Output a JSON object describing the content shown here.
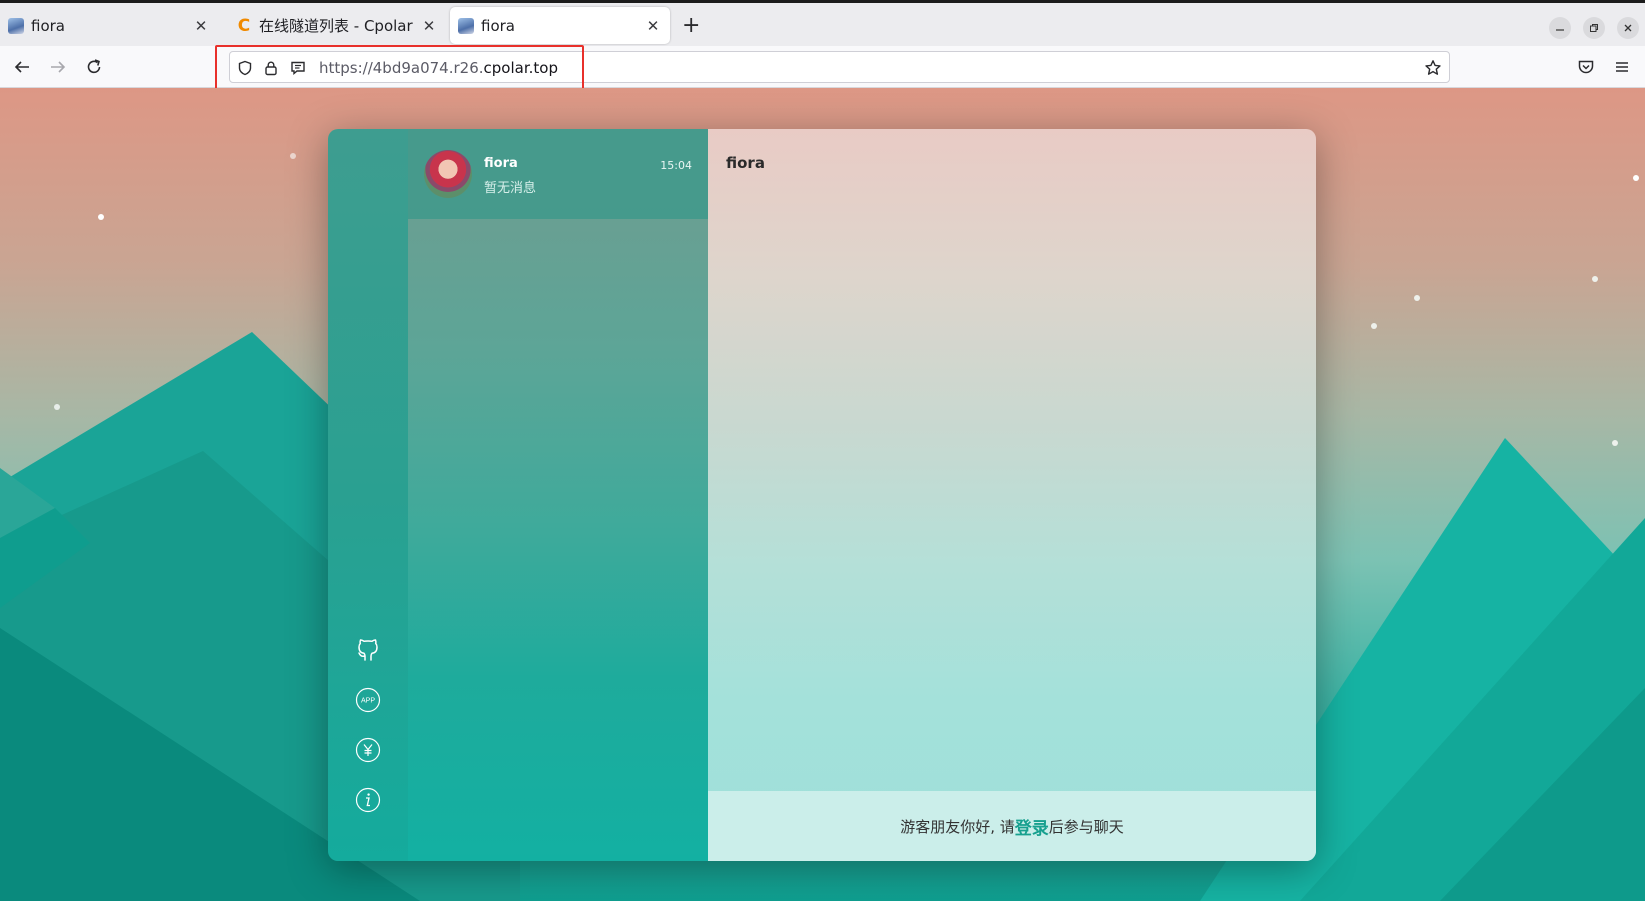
{
  "browser": {
    "tabs": [
      {
        "title": "fiora",
        "favicon": "fiora-favicon-icon",
        "active": false
      },
      {
        "title": "在线隧道列表 - Cpolar",
        "favicon": "cpolar-c-icon",
        "active": false
      },
      {
        "title": "fiora",
        "favicon": "fiora-favicon-icon",
        "active": true
      }
    ],
    "tab_close_glyph": "✕",
    "new_tab_glyph": "+",
    "url": {
      "prefix": "https://4bd9a074.r26.",
      "host": "cpolar.top"
    },
    "highlight_color": "#e8302b"
  },
  "chat_app": {
    "conversation": {
      "name": "fiora",
      "time": "15:04",
      "last_message": "暂无消息"
    },
    "header_title": "fiora",
    "footer": {
      "before": "游客朋友你好, 请",
      "login_link": "登录",
      "after": "后参与聊天"
    },
    "sidebar_icons": [
      "github-icon",
      "app-icon",
      "yen-icon",
      "info-icon"
    ],
    "app_icon_text": "APP",
    "accent_color": "#17a08f"
  }
}
